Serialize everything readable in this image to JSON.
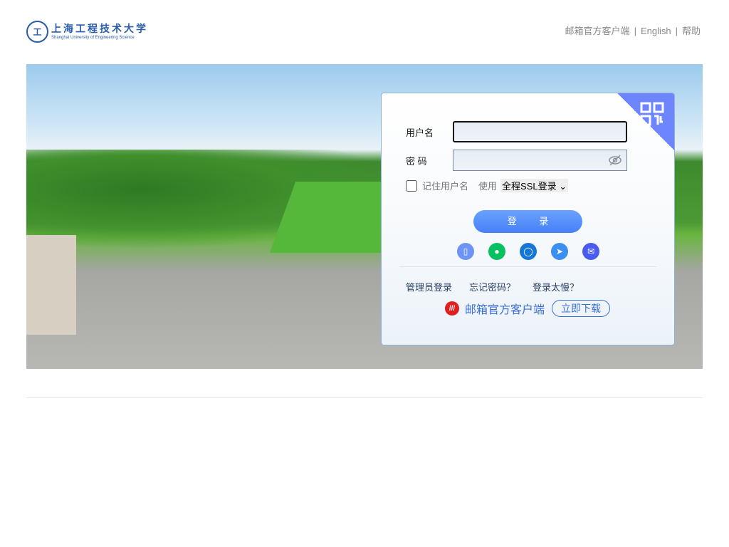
{
  "header": {
    "logo_cn": "上海工程技术大学",
    "logo_en": "Shanghai University of Engineering Science",
    "links": [
      "邮箱官方客户端",
      "English",
      "帮助"
    ],
    "separator": "|"
  },
  "login": {
    "username_label": "用户名",
    "username_value": "",
    "password_label": "密 码",
    "password_value": "",
    "remember_label": "记住用户名",
    "use_label": "使用",
    "ssl_selected": "全程SSL登录",
    "login_button": "登 录",
    "third_party_icons": [
      "mobile-icon",
      "wechat-icon",
      "chat-icon",
      "feishu-icon",
      "mail-app-icon"
    ],
    "links": [
      "管理员登录",
      "忘记密码？",
      "登录太慢？"
    ],
    "client_text": "邮箱官方客户端",
    "download_button": "立即下载"
  },
  "colors": {
    "accent": "#4680f7",
    "qr_corner": "#6d86ff",
    "logo": "#2a5caa"
  }
}
